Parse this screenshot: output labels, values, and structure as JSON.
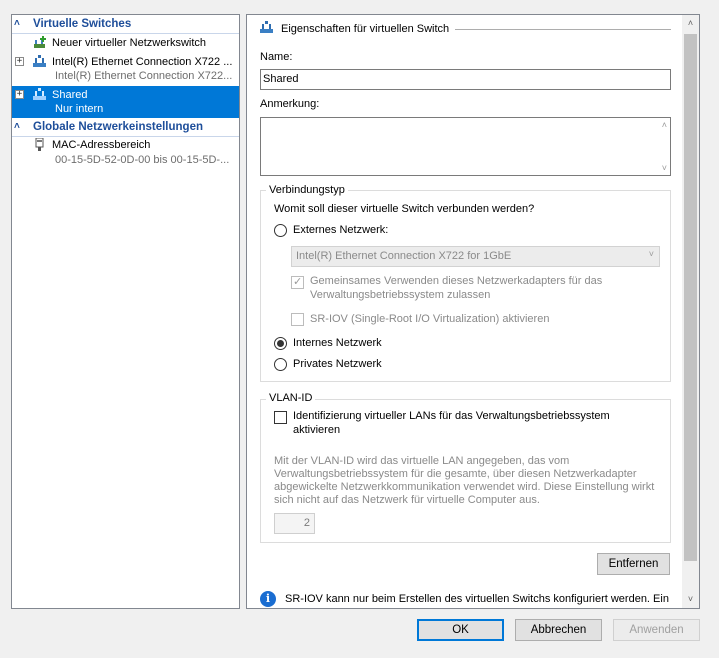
{
  "tree": {
    "virtual_switches_header": "Virtuelle Switches",
    "new_switch": "Neuer virtueller Netzwerkswitch",
    "intel_switch": {
      "name": "Intel(R) Ethernet Connection X722 ...",
      "subtitle": "Intel(R) Ethernet Connection X722..."
    },
    "shared_switch": {
      "name": "Shared",
      "subtitle": "Nur intern"
    },
    "global_header": "Globale Netzwerkeinstellungen",
    "mac_range": {
      "name": "MAC-Adressbereich",
      "subtitle": "00-15-5D-52-0D-00 bis 00-15-5D-..."
    }
  },
  "props": {
    "section_title": "Eigenschaften für virtuellen Switch",
    "name_label": "Name:",
    "name_value": "Shared",
    "note_label": "Anmerkung:",
    "note_value": "",
    "connection_type": {
      "title": "Verbindungstyp",
      "question": "Womit soll dieser virtuelle Switch verbunden werden?",
      "external_label": "Externes Netzwerk:",
      "adapter_selected": "Intel(R) Ethernet Connection X722 for 1GbE",
      "share_adapter_line1": "Gemeinsames Verwenden dieses Netzwerkadapters für das",
      "share_adapter_line2": "Verwaltungsbetriebssystem zulassen",
      "sriov_label": "SR-IOV (Single-Root I/O Virtualization) aktivieren",
      "internal_label": "Internes Netzwerk",
      "private_label": "Privates Netzwerk",
      "selected": "internal"
    },
    "vlan": {
      "title": "VLAN-ID",
      "enable_line1": "Identifizierung virtueller LANs für das Verwaltungsbetriebssystem",
      "enable_line2": "aktivieren",
      "desc_line1": "Mit der VLAN-ID wird das virtuelle LAN angegeben, das vom",
      "desc_line2": "Verwaltungsbetriebssystem für die gesamte, über diesen Netzwerkadapter",
      "desc_line3": "abgewickelte Netzwerkkommunikation verwendet wird. Diese Einstellung wirkt",
      "desc_line4": "sich nicht auf das Netzwerk für virtuelle Computer aus.",
      "value": "2"
    },
    "remove_button": "Entfernen",
    "info_text": "SR-IOV kann nur beim Erstellen des virtuellen Switchs konfiguriert werden. Ein"
  },
  "footer": {
    "ok": "OK",
    "cancel": "Abbrechen",
    "apply": "Anwenden"
  },
  "colors": {
    "selection": "#0078d7",
    "header_blue": "#1e4e9a",
    "info_blue": "#1a6dd1"
  }
}
